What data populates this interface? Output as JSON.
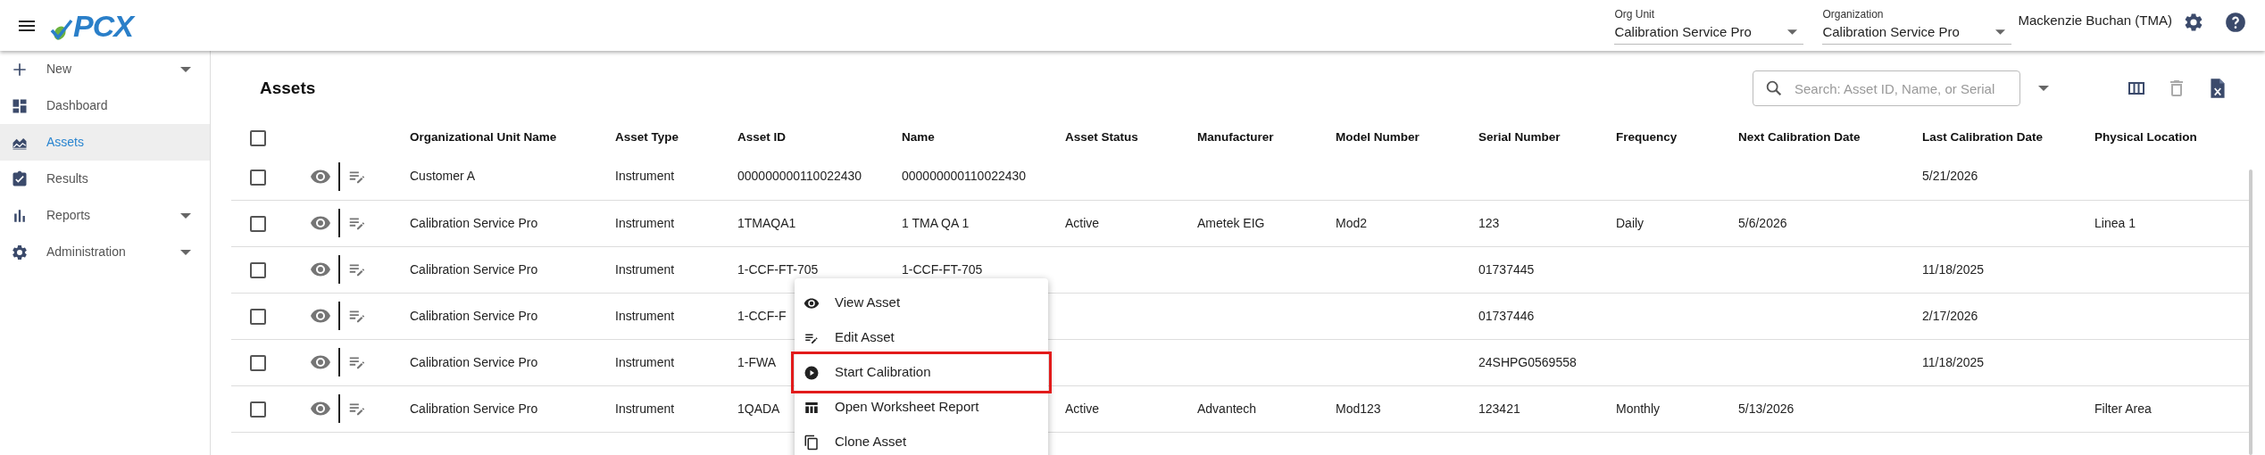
{
  "header": {
    "logo": "PCX",
    "org_unit": {
      "label": "Org Unit",
      "value": "Calibration Service Pro"
    },
    "organization": {
      "label": "Organization",
      "value": "Calibration Service Pro"
    },
    "user": "Mackenzie Buchan (TMA)"
  },
  "sidebar": {
    "items": [
      {
        "label": "New",
        "selected": false,
        "has_submenu": true
      },
      {
        "label": "Dashboard",
        "selected": false,
        "has_submenu": false
      },
      {
        "label": "Assets",
        "selected": true,
        "has_submenu": false
      },
      {
        "label": "Results",
        "selected": false,
        "has_submenu": false
      },
      {
        "label": "Reports",
        "selected": false,
        "has_submenu": true
      },
      {
        "label": "Administration",
        "selected": false,
        "has_submenu": true
      }
    ]
  },
  "page": {
    "title": "Assets",
    "search": {
      "placeholder": "Search: Asset ID, Name, or Serial"
    },
    "delete_disabled": true
  },
  "table": {
    "header_checked": false,
    "columns": [
      "Organizational Unit Name",
      "Asset Type",
      "Asset ID",
      "Name",
      "Asset Status",
      "Manufacturer",
      "Model Number",
      "Serial Number",
      "Frequency",
      "Next Calibration Date",
      "Last Calibration Date",
      "Physical Location"
    ],
    "rows": [
      {
        "checked": false,
        "cells": [
          "Customer A",
          "Instrument",
          "000000000110022430",
          "000000000110022430",
          null,
          null,
          null,
          null,
          null,
          null,
          "5/21/2026",
          null
        ]
      },
      {
        "checked": false,
        "cells": [
          "Calibration Service Pro",
          "Instrument",
          "1TMAQA1",
          "1 TMA QA 1",
          "Active",
          "Ametek EIG",
          "Mod2",
          "123",
          "Daily",
          "5/6/2026",
          null,
          "Linea 1"
        ]
      },
      {
        "checked": false,
        "cells": [
          "Calibration Service Pro",
          "Instrument",
          "1-CCF-FT-705",
          "1-CCF-FT-705",
          null,
          null,
          null,
          "01737445",
          null,
          null,
          "11/18/2025",
          null
        ]
      },
      {
        "checked": false,
        "cells": [
          "Calibration Service Pro",
          "Instrument",
          "1-CCF-F",
          null,
          null,
          null,
          null,
          "01737446",
          null,
          null,
          "2/17/2026",
          null
        ]
      },
      {
        "checked": false,
        "cells": [
          "Calibration Service Pro",
          "Instrument",
          "1-FWA",
          null,
          null,
          null,
          null,
          "24SHPG0569558",
          null,
          null,
          "11/18/2025",
          null
        ]
      },
      {
        "checked": false,
        "cells": [
          "Calibration Service Pro",
          "Instrument",
          "1QADA",
          null,
          "Active",
          "Advantech",
          "Mod123",
          "123421",
          "Monthly",
          "5/13/2026",
          null,
          "Filter Area"
        ]
      }
    ]
  },
  "context_menu": {
    "items": [
      {
        "label": "View Asset",
        "highlighted": false
      },
      {
        "label": "Edit Asset",
        "highlighted": false
      },
      {
        "label": "Start Calibration",
        "highlighted": true
      },
      {
        "label": "Open Worksheet Report",
        "highlighted": false
      },
      {
        "label": "Clone Asset",
        "highlighted": false
      }
    ]
  }
}
